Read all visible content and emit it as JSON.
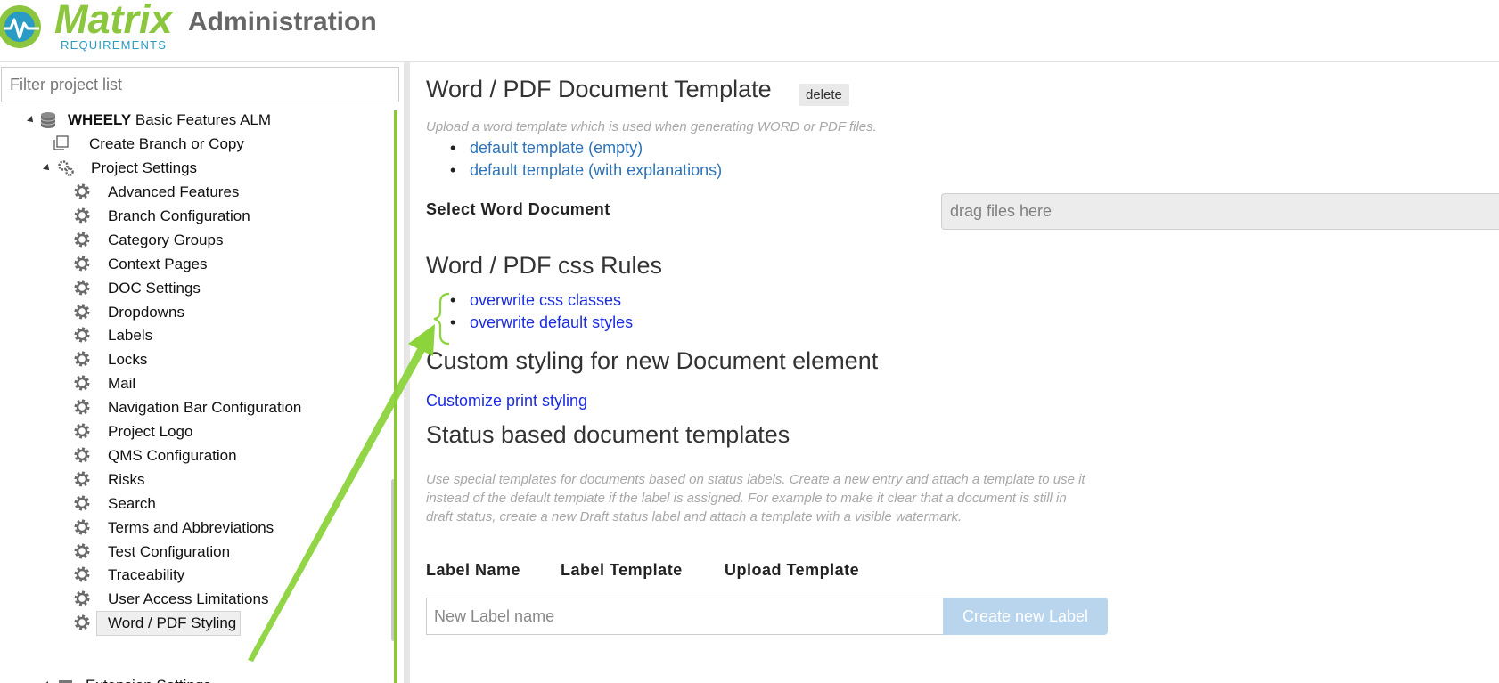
{
  "header": {
    "brand_name": "Matrix",
    "brand_sub": "REQUIREMENTS",
    "app_title": "Administration",
    "brand_colors": {
      "green": "#8cc63e",
      "blue": "#2a9bc4"
    }
  },
  "sidebar": {
    "filter_placeholder": "Filter project list",
    "project": {
      "code": "WHEELY",
      "name": "Basic Features ALM",
      "icon": "database-icon"
    },
    "create_branch": {
      "label": "Create Branch or Copy",
      "icon": "copy-icon"
    },
    "project_settings": {
      "label": "Project Settings",
      "icon": "gears-icon"
    },
    "settings_items": [
      "Advanced Features",
      "Branch Configuration",
      "Category Groups",
      "Context Pages",
      "DOC Settings",
      "Dropdowns",
      "Labels",
      "Locks",
      "Mail",
      "Navigation Bar Configuration",
      "Project Logo",
      "QMS Configuration",
      "Risks",
      "Search",
      "Terms and Abbreviations",
      "Test Configuration",
      "Traceability",
      "User Access Limitations",
      "Word / PDF Styling"
    ],
    "selected_item": "Word / PDF Styling",
    "extension_settings": {
      "label": "Extension Settings",
      "icon": "puzzle-icon"
    },
    "accent_color": "#8cc63e"
  },
  "main": {
    "template_section": {
      "title": "Word / PDF Document Template",
      "delete_label": "delete",
      "hint": "Upload a word template which is used when generating WORD or PDF files.",
      "links": [
        "default template (empty)",
        "default template (with explanations)"
      ]
    },
    "select_doc": {
      "label": "Select Word Document",
      "drop_placeholder": "drag files here"
    },
    "css_section": {
      "title": "Word / PDF css Rules",
      "links": [
        "overwrite css classes",
        "overwrite default styles"
      ]
    },
    "custom_section": {
      "title": "Custom styling for new Document element",
      "link": "Customize print styling"
    },
    "status_section": {
      "title": "Status based document templates",
      "hint": "Use special templates for documents based on status labels. Create a new entry and attach a template to use it instead of the default template if the label is assigned. For example to make it clear that a document is still in draft status, create a new Draft status label and attach a template with a visible watermark.",
      "col_label_name": "Label Name",
      "col_label_template": "Label Template",
      "col_upload_template": "Upload Template",
      "new_label_placeholder": "New Label name",
      "create_button": "Create new Label"
    }
  },
  "annotation": {
    "color": "#8cd33c",
    "icon": "green-arrow-annotation"
  }
}
